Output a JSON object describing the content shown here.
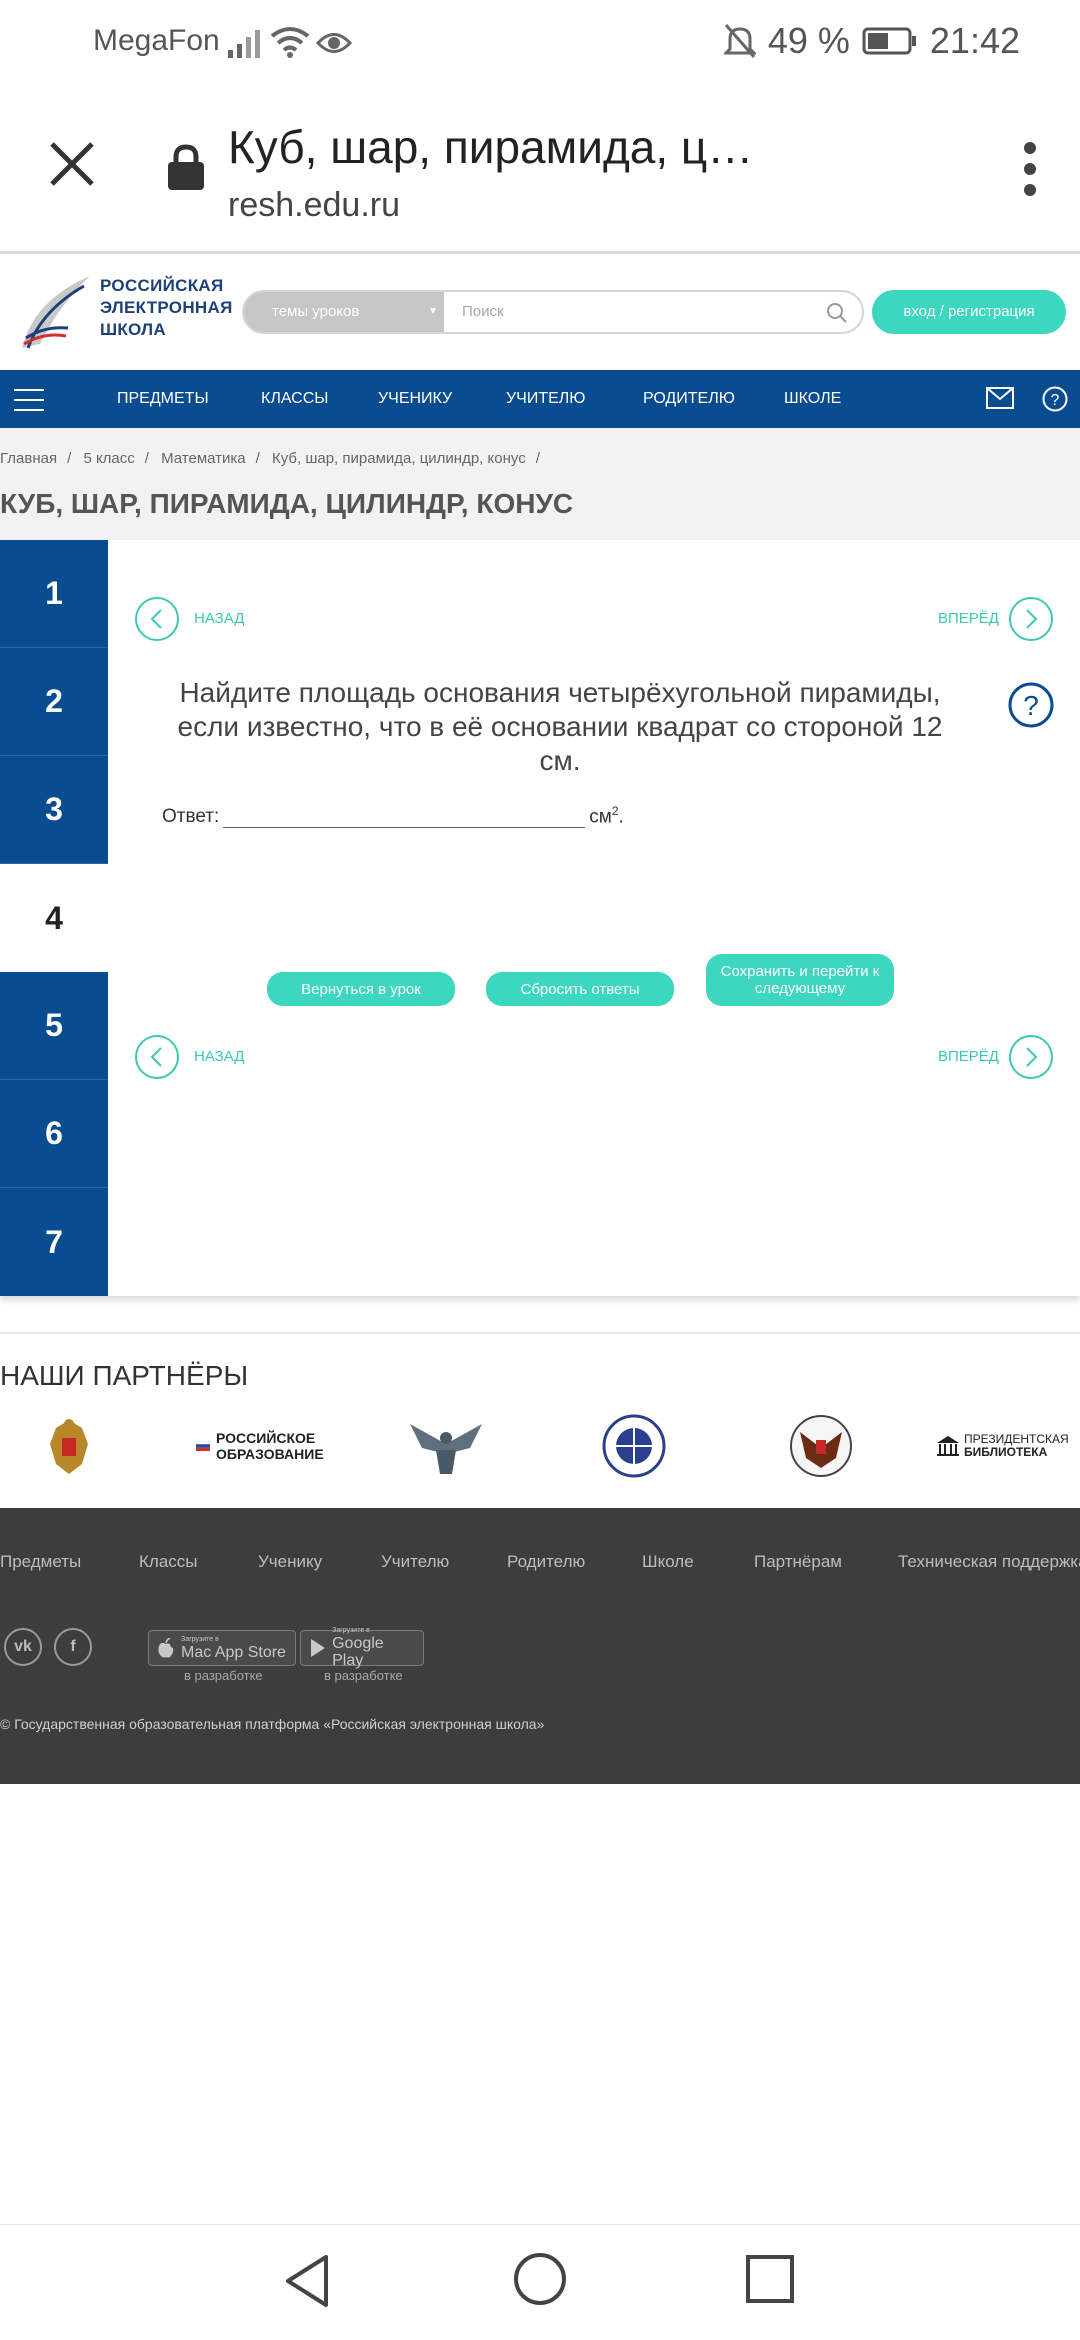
{
  "status_bar": {
    "carrier": "MegaFon",
    "battery": "49 %",
    "time": "21:42",
    "icons": [
      "signal-icon",
      "wifi-icon",
      "eye-icon",
      "bell-off-icon",
      "battery-icon"
    ]
  },
  "browser": {
    "title": "Куб, шар, пирамида, ц…",
    "url": "resh.edu.ru"
  },
  "site": {
    "logo_lines": [
      "РОССИЙСКАЯ",
      "ЭЛЕКТРОННАЯ",
      "ШКОЛА"
    ],
    "topics_label": "темы уроков",
    "search_placeholder": "Поиск",
    "login_label": "вход / регистрация"
  },
  "nav": {
    "items": [
      "ПРЕДМЕТЫ",
      "КЛАССЫ",
      "УЧЕНИКУ",
      "УЧИТЕЛЮ",
      "РОДИТЕЛЮ",
      "ШКОЛЕ"
    ]
  },
  "breadcrumb": {
    "items": [
      "Главная",
      "5 класс",
      "Математика",
      "Куб, шар, пирамида, цилиндр, конус"
    ],
    "separator": "/"
  },
  "page_title": "КУБ, ШАР, ПИРАМИДА, ЦИЛИНДР, КОНУС",
  "task": {
    "tabs": [
      "1",
      "2",
      "3",
      "4",
      "5",
      "6",
      "7"
    ],
    "active_tab": "4",
    "back_label": "НАЗАД",
    "forward_label": "ВПЕРЁД",
    "question": "Найдите площадь основания четырёхугольной пирамиды, если известно, что в её основании квадрат со стороной 12 см.",
    "answer_label": "Ответ:",
    "unit": "см",
    "unit_sup": "2",
    "unit_end": ".",
    "buttons": {
      "return": "Вернуться в урок",
      "reset": "Сбросить ответы",
      "save_next": "Сохранить и перейти к следующему"
    }
  },
  "partners": {
    "title": "НАШИ ПАРТНЁРЫ",
    "ro_lines": [
      "РОССИЙСКОЕ",
      "ОБРАЗОВАНИЕ"
    ],
    "pb_lines": [
      "ПРЕЗИДЕНТСКАЯ",
      "БИБЛИОТЕКА"
    ]
  },
  "footer": {
    "links": [
      "Предметы",
      "Классы",
      "Ученику",
      "Учителю",
      "Родителю",
      "Школе",
      "Партнёрам",
      "Техническая поддержка"
    ],
    "social": [
      "vk",
      "f"
    ],
    "stores": [
      {
        "small": "Загрузите в",
        "big": "Mac App Store",
        "note": "в разработке"
      },
      {
        "small": "Загрузите в",
        "big": "Google Play",
        "note": "в разработке"
      }
    ],
    "copyright": "© Государственная образовательная платформа «Российская электронная школа»"
  },
  "colors": {
    "primary_blue": "#0a4c90",
    "accent_teal": "#3dd6bf",
    "footer_bg": "#3d3d3d"
  }
}
